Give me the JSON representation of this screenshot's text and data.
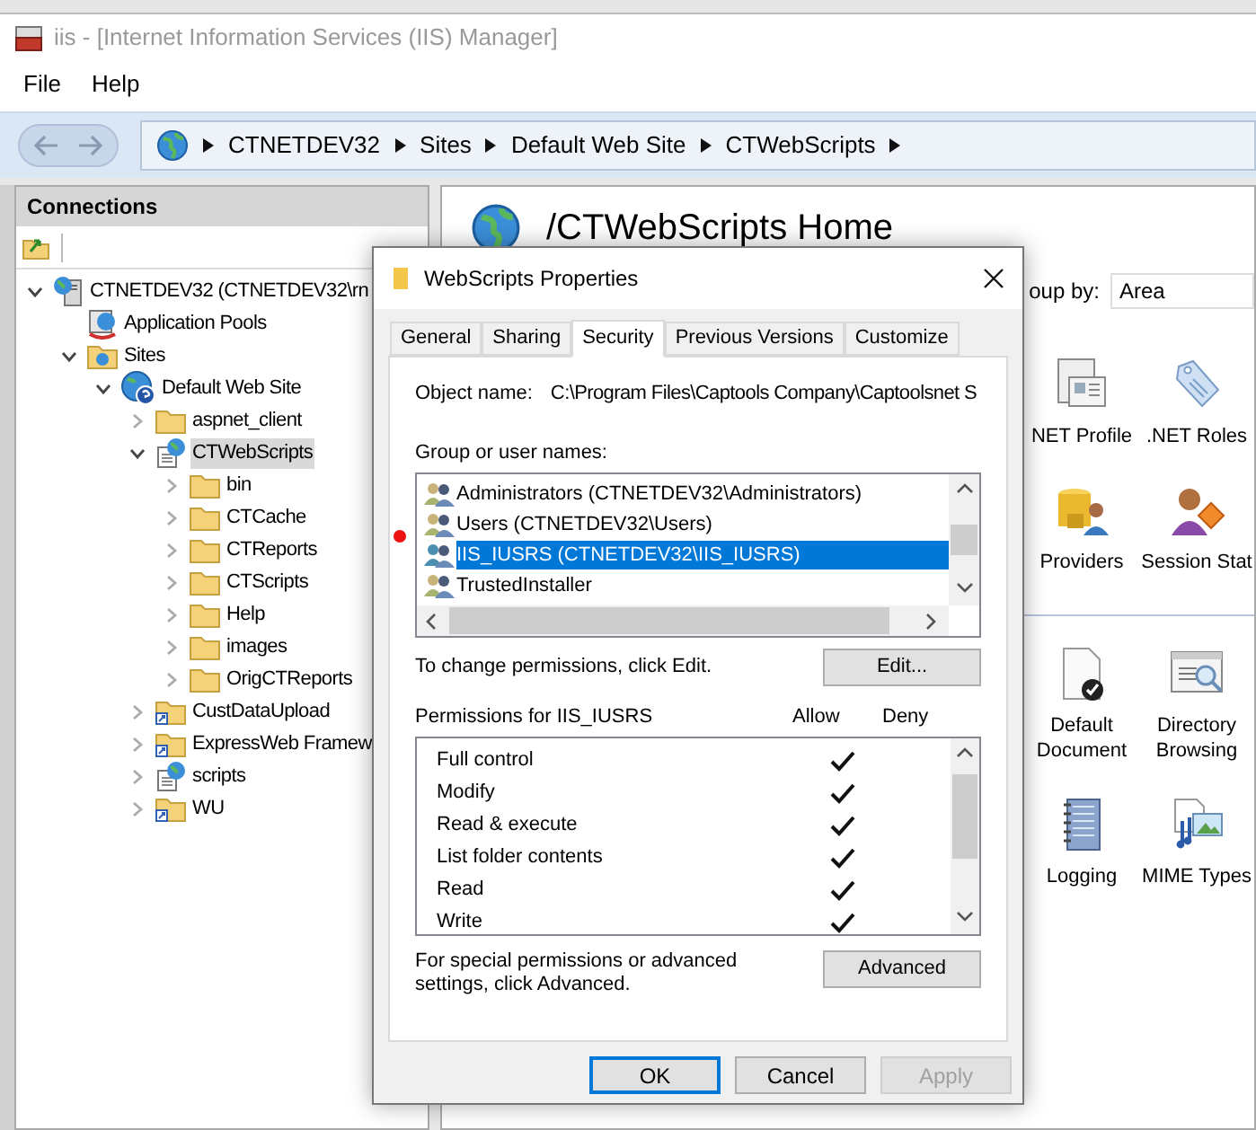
{
  "window": {
    "title": "iis - [Internet Information Services (IIS) Manager]"
  },
  "menu": [
    "File",
    "Help"
  ],
  "breadcrumb": [
    "CTNETDEV32",
    "Sites",
    "Default Web Site",
    "CTWebScripts"
  ],
  "connections": {
    "title": "Connections",
    "tree": [
      {
        "label": "CTNETDEV32 (CTNETDEV32\\rn",
        "kind": "server",
        "expanded": true,
        "selected": false,
        "children": [
          {
            "label": "Application Pools",
            "kind": "pools",
            "selected": false
          },
          {
            "label": "Sites",
            "kind": "sites",
            "expanded": true,
            "selected": false,
            "children": [
              {
                "label": "Default Web Site",
                "kind": "website",
                "expanded": true,
                "selected": false,
                "children": [
                  {
                    "label": "aspnet_client",
                    "kind": "folder",
                    "expanded": false,
                    "selected": false
                  },
                  {
                    "label": "CTWebScripts",
                    "kind": "app",
                    "expanded": true,
                    "selected": true,
                    "children": [
                      {
                        "label": "bin",
                        "kind": "folder",
                        "expanded": false,
                        "selected": false
                      },
                      {
                        "label": "CTCache",
                        "kind": "folder",
                        "expanded": false,
                        "selected": false
                      },
                      {
                        "label": "CTReports",
                        "kind": "folder",
                        "expanded": false,
                        "selected": false
                      },
                      {
                        "label": "CTScripts",
                        "kind": "folder",
                        "expanded": false,
                        "selected": false
                      },
                      {
                        "label": "Help",
                        "kind": "folder",
                        "expanded": false,
                        "selected": false
                      },
                      {
                        "label": "images",
                        "kind": "folder",
                        "expanded": false,
                        "selected": false
                      },
                      {
                        "label": "OrigCTReports",
                        "kind": "folder",
                        "expanded": false,
                        "selected": false
                      }
                    ]
                  },
                  {
                    "label": "CustDataUpload",
                    "kind": "vdir",
                    "expanded": false,
                    "selected": false
                  },
                  {
                    "label": "ExpressWeb Framew",
                    "kind": "vdir",
                    "expanded": false,
                    "selected": false
                  },
                  {
                    "label": "scripts",
                    "kind": "app",
                    "expanded": false,
                    "selected": false
                  },
                  {
                    "label": "WU",
                    "kind": "vdir",
                    "expanded": false,
                    "selected": false
                  }
                ]
              }
            ]
          }
        ]
      }
    ]
  },
  "home": {
    "title": "/CTWebScripts Home",
    "group_by_label": "oup by:",
    "group_by_value": "Area",
    "sections": [
      {
        "features": [
          {
            "label": "NET Profile",
            "kind": "profile"
          },
          {
            "label": ".NET Roles",
            "kind": "tag"
          },
          {
            "label": "Providers",
            "kind": "providers"
          },
          {
            "label": "Session Stat",
            "kind": "session"
          }
        ]
      },
      {
        "features": [
          {
            "label": "Default Document",
            "kind": "document"
          },
          {
            "label": "Directory Browsing",
            "kind": "browse"
          },
          {
            "label": "Logging",
            "kind": "log"
          },
          {
            "label": "MIME Types",
            "kind": "mime"
          }
        ]
      }
    ]
  },
  "dialog": {
    "title": "WebScripts Properties",
    "tabs": [
      {
        "label": "General",
        "selected": false
      },
      {
        "label": "Sharing",
        "selected": false
      },
      {
        "label": "Security",
        "selected": true
      },
      {
        "label": "Previous Versions",
        "selected": false
      },
      {
        "label": "Customize",
        "selected": false
      }
    ],
    "object_name_label": "Object name:",
    "object_name": "C:\\Program Files\\Captools Company\\Captoolsnet S",
    "groups_label": "Group or user names:",
    "groups": [
      {
        "name": "Administrators (CTNETDEV32\\Administrators)",
        "selected": false
      },
      {
        "name": "Users (CTNETDEV32\\Users)",
        "selected": false
      },
      {
        "name": "IIS_IUSRS (CTNETDEV32\\IIS_IUSRS)",
        "selected": true
      },
      {
        "name": "TrustedInstaller",
        "selected": false
      }
    ],
    "edit_hint": "To change permissions, click Edit.",
    "edit_button": "Edit...",
    "permissions_label": "Permissions for IIS_IUSRS",
    "allow_label": "Allow",
    "deny_label": "Deny",
    "permissions": [
      {
        "name": "Full control",
        "allow": true,
        "deny": false
      },
      {
        "name": "Modify",
        "allow": true,
        "deny": false
      },
      {
        "name": "Read & execute",
        "allow": true,
        "deny": false
      },
      {
        "name": "List folder contents",
        "allow": true,
        "deny": false
      },
      {
        "name": "Read",
        "allow": true,
        "deny": false
      },
      {
        "name": "Write",
        "allow": true,
        "deny": false
      }
    ],
    "advanced_hint": "For special permissions or advanced settings, click Advanced.",
    "advanced_button": "Advanced",
    "buttons": [
      {
        "label": "OK",
        "kind": "default",
        "disabled": false
      },
      {
        "label": "Cancel",
        "kind": "normal",
        "disabled": false
      },
      {
        "label": "Apply",
        "kind": "normal",
        "disabled": true
      }
    ]
  }
}
